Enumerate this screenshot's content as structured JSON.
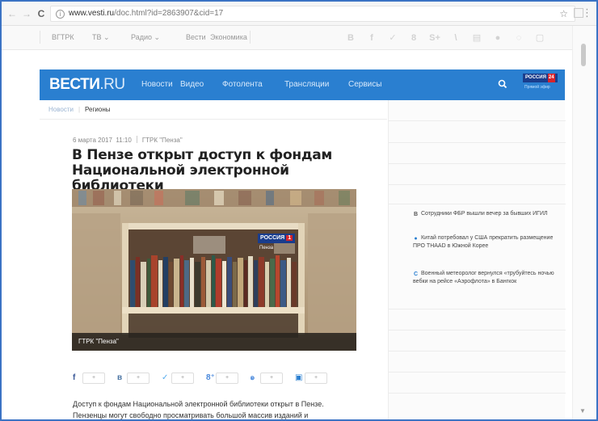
{
  "browser": {
    "url_prefix": "www.vesti.ru",
    "url_path": "/doc.html?id=2863907&cid=17",
    "back_glyph": "←",
    "forward_glyph": "→",
    "reload_glyph": "C",
    "info_glyph": "i",
    "star_glyph": "☆",
    "menu_glyph": "⋮"
  },
  "bookmarks": {
    "items": [
      "ВГТРК",
      "ТВ",
      "Радио",
      "Вести",
      "Экономика"
    ],
    "chevron": "⌄"
  },
  "social_bookmarks": [
    "B",
    "f",
    "✓",
    "8",
    "S+",
    "\\",
    "▤",
    "●",
    "◌",
    "▢"
  ],
  "site": {
    "logo_main": "ВЕСТИ",
    "logo_ru": ".RU",
    "nav": [
      "Новости",
      "Видео",
      "Фотолента",
      "Трансляции",
      "Сервисы"
    ],
    "badge_text": "РОССИЯ",
    "badge_number": "24",
    "badge_sub": "Прямой эфир"
  },
  "breadcrumb": {
    "home": "Новости",
    "current": "Регионы"
  },
  "article": {
    "date": "6 марта 2017",
    "time": "11:10",
    "source": "ГТРК \"Пенза\"",
    "title": "В Пензе открыт доступ к фондам Национальной электронной библиотеки",
    "photo_caption": "ГТРК \"Пенза\"",
    "tv_logo": "РОССИЯ",
    "tv_number": "1",
    "tv_city": "Пенза",
    "body": "Доступ к фондам Национальной электронной библиотеки открыт в Пензе. Пензенцы могут свободно просматривать большой массив изданий и"
  },
  "share": [
    {
      "icon": "f",
      "count": "+",
      "color": "#3b5998"
    },
    {
      "icon": "в",
      "count": "+",
      "color": "#4c75a3"
    },
    {
      "icon": "✓",
      "count": "+",
      "color": "#55acee"
    },
    {
      "icon": "8⁺",
      "count": "+",
      "color": "#4a89dc"
    },
    {
      "icon": "ꭷ",
      "count": "+",
      "color": "#4a89dc"
    },
    {
      "icon": "▣",
      "count": "+",
      "color": "#2a7fd0"
    }
  ],
  "sidebar_news": [
    {
      "icon": "В",
      "color": "#555555",
      "text": "Сотрудники ФБР вышли вечер за бывших ИГИЛ"
    },
    {
      "icon": "●",
      "color": "#2a7fd0",
      "text": "Китай потребовал у США прекратить размещение ПРО THAAD в Южной Корее"
    },
    {
      "icon": "С",
      "color": "#2a7fd0",
      "text": "Военный метеоролог вернулся «трубуйтесь ночью вебки на рейсе «Аэрофлота» в Бангкок"
    }
  ]
}
